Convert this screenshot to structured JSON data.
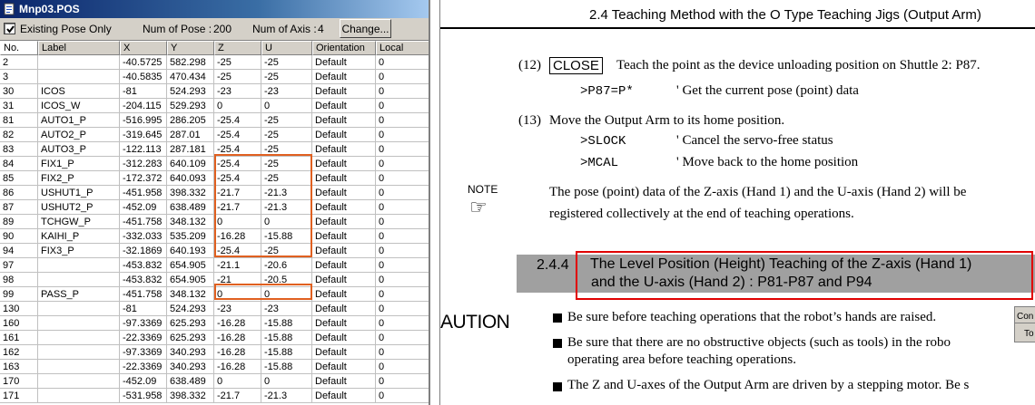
{
  "window": {
    "title": "Mnp03.POS"
  },
  "toolbar": {
    "existing_label": "Existing Pose Only",
    "existing_checked": true,
    "num_pose_label": "Num of Pose :",
    "num_pose": "200",
    "num_axis_label": "Num of Axis :",
    "num_axis": "4",
    "change_label": "Change..."
  },
  "grid": {
    "columns": [
      "No.",
      "Label",
      "X",
      "Y",
      "Z",
      "U",
      "Orientation",
      "Local"
    ],
    "rows": [
      [
        "2",
        "",
        "-40.5725",
        "582.298",
        "-25",
        "-25",
        "Default",
        "0"
      ],
      [
        "3",
        "",
        "-40.5835",
        "470.434",
        "-25",
        "-25",
        "Default",
        "0"
      ],
      [
        "30",
        "ICOS",
        "-81",
        "524.293",
        "-23",
        "-23",
        "Default",
        "0"
      ],
      [
        "31",
        "ICOS_W",
        "-204.115",
        "529.293",
        "0",
        "0",
        "Default",
        "0"
      ],
      [
        "81",
        "AUTO1_P",
        "-516.995",
        "286.205",
        "-25.4",
        "-25",
        "Default",
        "0"
      ],
      [
        "82",
        "AUTO2_P",
        "-319.645",
        "287.01",
        "-25.4",
        "-25",
        "Default",
        "0"
      ],
      [
        "83",
        "AUTO3_P",
        "-122.113",
        "287.181",
        "-25.4",
        "-25",
        "Default",
        "0"
      ],
      [
        "84",
        "FIX1_P",
        "-312.283",
        "640.109",
        "-25.4",
        "-25",
        "Default",
        "0"
      ],
      [
        "85",
        "FIX2_P",
        "-172.372",
        "640.093",
        "-25.4",
        "-25",
        "Default",
        "0"
      ],
      [
        "86",
        "USHUT1_P",
        "-451.958",
        "398.332",
        "-21.7",
        "-21.3",
        "Default",
        "0"
      ],
      [
        "87",
        "USHUT2_P",
        "-452.09",
        "638.489",
        "-21.7",
        "-21.3",
        "Default",
        "0"
      ],
      [
        "89",
        "TCHGW_P",
        "-451.758",
        "348.132",
        "0",
        "0",
        "Default",
        "0"
      ],
      [
        "90",
        "KAIHI_P",
        "-332.033",
        "535.209",
        "-16.28",
        "-15.88",
        "Default",
        "0"
      ],
      [
        "94",
        "FIX3_P",
        "-32.1869",
        "640.193",
        "-25.4",
        "-25",
        "Default",
        "0"
      ],
      [
        "97",
        "",
        "-453.832",
        "654.905",
        "-21.1",
        "-20.6",
        "Default",
        "0"
      ],
      [
        "98",
        "",
        "-453.832",
        "654.905",
        "-21",
        "-20.5",
        "Default",
        "0"
      ],
      [
        "99",
        "PASS_P",
        "-451.758",
        "348.132",
        "0",
        "0",
        "Default",
        "0"
      ],
      [
        "130",
        "",
        "-81",
        "524.293",
        "-23",
        "-23",
        "Default",
        "0"
      ],
      [
        "160",
        "",
        "-97.3369",
        "625.293",
        "-16.28",
        "-15.88",
        "Default",
        "0"
      ],
      [
        "161",
        "",
        "-22.3369",
        "625.293",
        "-16.28",
        "-15.88",
        "Default",
        "0"
      ],
      [
        "162",
        "",
        "-97.3369",
        "340.293",
        "-16.28",
        "-15.88",
        "Default",
        "0"
      ],
      [
        "163",
        "",
        "-22.3369",
        "340.293",
        "-16.28",
        "-15.88",
        "Default",
        "0"
      ],
      [
        "170",
        "",
        "-452.09",
        "638.489",
        "0",
        "0",
        "Default",
        "0"
      ],
      [
        "171",
        "",
        "-531.958",
        "398.332",
        "-21.7",
        "-21.3",
        "Default",
        "0"
      ]
    ]
  },
  "doc": {
    "header": "2.4   Teaching Method with the O Type Teaching Jigs (Output Arm)",
    "step12_num": "(12)",
    "step12_key": "CLOSE",
    "step12_text": "Teach the point as the device unloading position on Shuttle 2: P87.",
    "step12_cmd": ">P87=P*",
    "step12_comment": "' Get the current pose (point) data",
    "step13_num": "(13)",
    "step13_text": "Move the Output Arm to its home position.",
    "step13_cmd1": ">SLOCK",
    "step13_comment1": "' Cancel the servo-free status",
    "step13_cmd2": ">MCAL",
    "step13_comment2": "' Move back to the home position",
    "note_label": "NOTE",
    "note_line1": "The pose (point) data of the Z-axis (Hand 1) and the U-axis (Hand 2) will be",
    "note_line2": "registered collectively at the end of teaching operations.",
    "section_num": "2.4.4",
    "section_title1": "The Level Position (Height) Teaching of the Z-axis (Hand 1)",
    "section_title2": "and the U-axis (Hand 2) : P81-P87 and P94",
    "caution_label": "AUTION",
    "bullet1": "Be sure before teaching operations that the robot’s hands are raised.",
    "bullet2_line1": "Be sure that there are no obstructive objects (such as tools) in the robo",
    "bullet2_line2": "operating area before teaching operations.",
    "bullet3_line1": "The Z and U-axes of the Output Arm are driven by a stepping motor.    Be s",
    "dialog_t1": "Con",
    "dialog_t2": "To"
  }
}
